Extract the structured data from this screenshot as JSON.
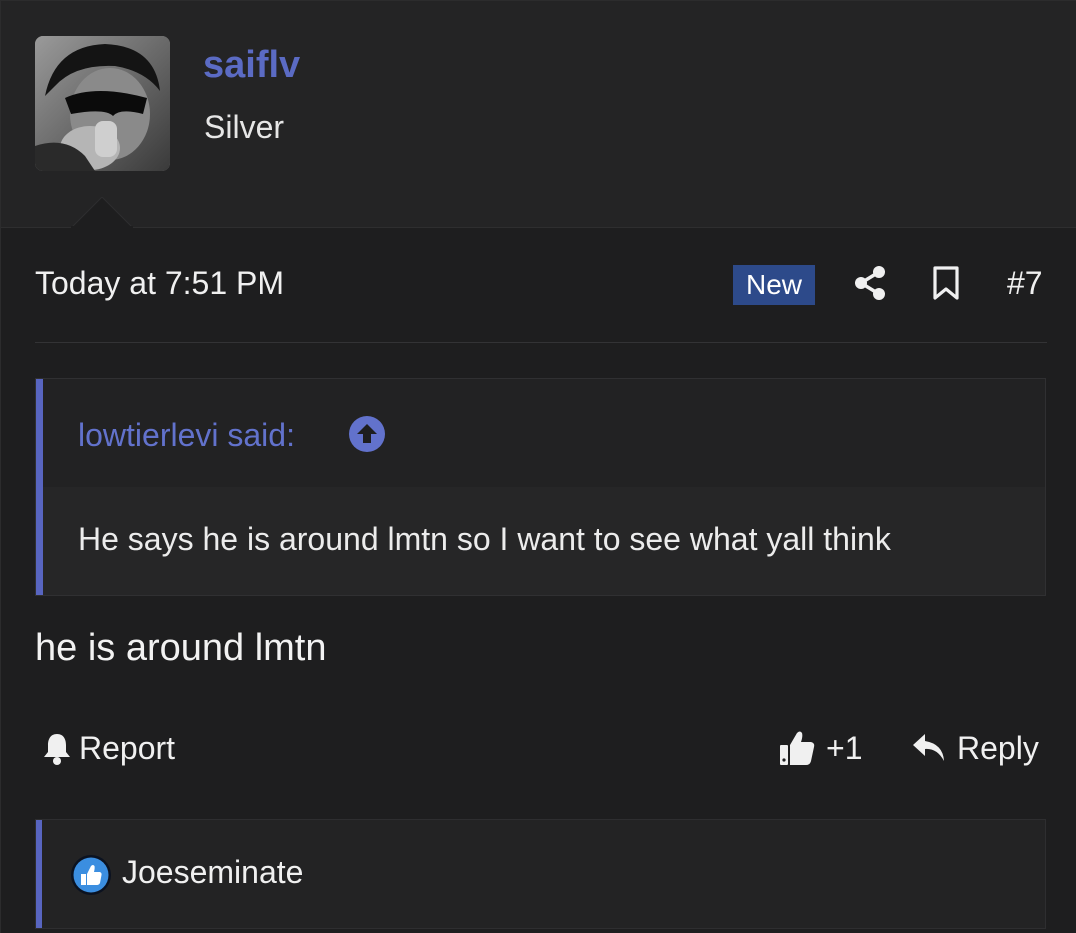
{
  "author": {
    "username": "saiflv",
    "title": "Silver",
    "avatar": "user-avatar-photo"
  },
  "meta": {
    "timestamp": "Today at 7:51 PM",
    "badge": "New",
    "share_icon": "share-icon",
    "bookmark_icon": "bookmark-icon",
    "post_number": "#7"
  },
  "quote": {
    "attribution": "lowtierlevi said:",
    "jump_icon": "arrow-up-circle-icon",
    "text": "He says he is around lmtn so I want to see what yall think"
  },
  "post": {
    "body": "he is around lmtn"
  },
  "actions": {
    "report_label": "Report",
    "like_label": "+1",
    "reply_label": "Reply"
  },
  "reactions": {
    "icon": "like-reaction-icon",
    "users": "Joeseminate"
  },
  "colors": {
    "background": "#1e1e1f",
    "accent": "#5b6bc4",
    "badge": "#2d4a8a",
    "text": "#ececec"
  }
}
